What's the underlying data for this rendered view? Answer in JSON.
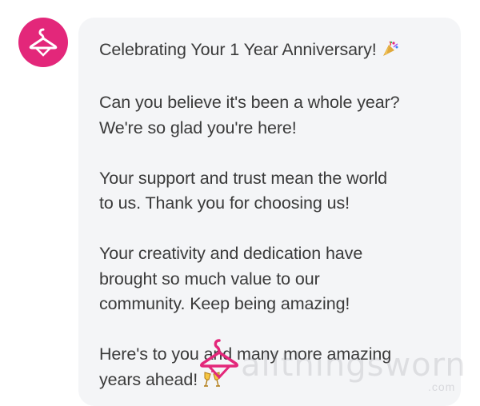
{
  "avatar": {
    "icon": "hanger-icon",
    "color": "#e3277a"
  },
  "message": {
    "title": "Celebrating Your 1 Year Anniversary!",
    "title_emoji": "party-popper-icon",
    "p1_line1": "Can you believe it's been a whole year?",
    "p1_line2": "We're so glad you're here!",
    "p2_line1": "Your support and trust mean the world",
    "p2_line2": "to us. Thank you for choosing us!",
    "p3_line1": "Your creativity and dedication have",
    "p3_line2": "brought so much value to our",
    "p3_line3": "community. Keep being amazing!",
    "p4_line1": "Here's to you and many more amazing",
    "p4_line2": "years ahead!",
    "closing_emoji": "cheers-glasses-icon"
  },
  "watermark": {
    "text": "allthingsworn",
    "suffix": ".com"
  }
}
